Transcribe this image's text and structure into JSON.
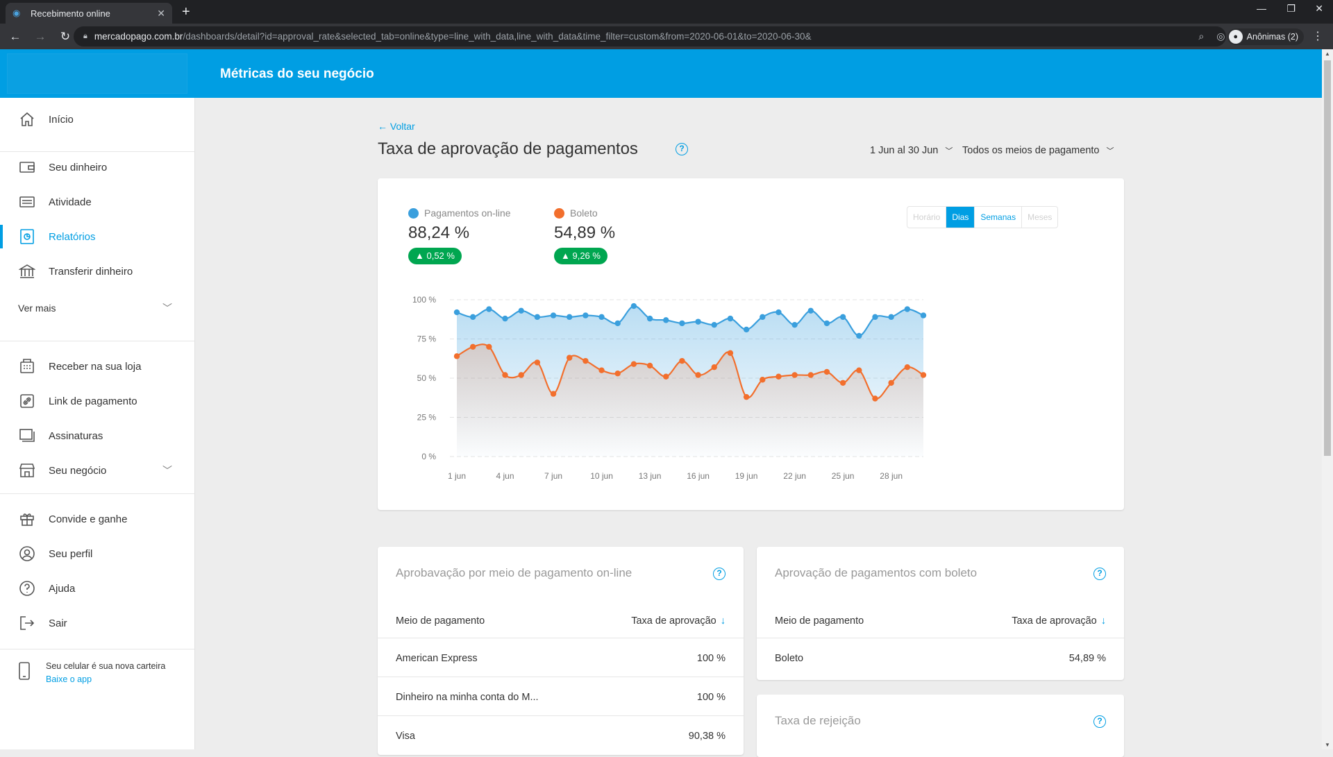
{
  "browser": {
    "tab_title": "Recebimento online",
    "new_tab": "+",
    "url_host": "mercadopago.com.br",
    "url_path": "/dashboards/detail?id=approval_rate&selected_tab=online&type=line_with_data,line_with_data&time_filter=custom&from=2020-06-01&to=2020-06-30&",
    "profile_label": "Anônimas (2)"
  },
  "header": {
    "title": "Métricas do seu negócio"
  },
  "sidebar": {
    "items": [
      {
        "label": "Início"
      },
      {
        "label": "Seu dinheiro"
      },
      {
        "label": "Atividade"
      },
      {
        "label": "Relatórios"
      },
      {
        "label": "Transferir dinheiro"
      },
      {
        "label": "Ver mais"
      },
      {
        "label": "Receber na sua loja"
      },
      {
        "label": "Link de pagamento"
      },
      {
        "label": "Assinaturas"
      },
      {
        "label": "Seu negócio"
      },
      {
        "label": "Convide e ganhe"
      },
      {
        "label": "Seu perfil"
      },
      {
        "label": "Ajuda"
      },
      {
        "label": "Sair"
      }
    ],
    "promo_text": "Seu celular é sua nova carteira",
    "promo_link": "Baixe o app"
  },
  "main": {
    "back": "← Voltar",
    "title": "Taxa de aprovação de pagamentos",
    "date_filter": "1 Jun al 30 Jun",
    "method_filter": "Todos os meios de pagamento"
  },
  "summary": {
    "online": {
      "label": "Pagamentos on-line",
      "value": "88,24 %",
      "delta": "▲ 0,52 %",
      "color": "#3a9fdd"
    },
    "boleto": {
      "label": "Boleto",
      "value": "54,89 %",
      "delta": "▲ 9,26 %",
      "color": "#f26f2d"
    }
  },
  "granularity": {
    "options": [
      "Horário",
      "Dias",
      "Semanas",
      "Meses"
    ],
    "selected": "Dias"
  },
  "chart_data": {
    "type": "area",
    "x": [
      "1 jun",
      "2 jun",
      "3 jun",
      "4 jun",
      "5 jun",
      "6 jun",
      "7 jun",
      "8 jun",
      "9 jun",
      "10 jun",
      "11 jun",
      "12 jun",
      "13 jun",
      "14 jun",
      "15 jun",
      "16 jun",
      "17 jun",
      "18 jun",
      "19 jun",
      "20 jun",
      "21 jun",
      "22 jun",
      "23 jun",
      "24 jun",
      "25 jun",
      "26 jun",
      "27 jun",
      "28 jun",
      "29 jun",
      "30 jun"
    ],
    "x_tick_labels": [
      "1 jun",
      "4 jun",
      "7 jun",
      "10 jun",
      "13 jun",
      "16 jun",
      "19 jun",
      "22 jun",
      "25 jun",
      "28 jun"
    ],
    "y_tick_labels": [
      "100 %",
      "75 %",
      "50 %",
      "25 %",
      "0 %"
    ],
    "ylim": [
      0,
      100
    ],
    "series": [
      {
        "name": "Pagamentos on-line",
        "color": "#3a9fdd",
        "values": [
          92,
          89,
          94,
          88,
          93,
          89,
          90,
          89,
          90,
          89,
          85,
          96,
          88,
          87,
          85,
          86,
          84,
          88,
          81,
          89,
          92,
          84,
          93,
          85,
          89,
          77,
          89,
          89,
          94,
          90
        ]
      },
      {
        "name": "Boleto",
        "color": "#f26f2d",
        "values": [
          64,
          70,
          70,
          52,
          52,
          60,
          40,
          63,
          61,
          55,
          53,
          59,
          58,
          51,
          61,
          52,
          57,
          66,
          38,
          49,
          51,
          52,
          52,
          54,
          47,
          55,
          37,
          47,
          57,
          52
        ]
      }
    ]
  },
  "table_online": {
    "title": "Aprobavação por meio de pagamento on-line",
    "col1": "Meio de pagamento",
    "col2": "Taxa de aprovação",
    "arrow": "↓",
    "rows": [
      {
        "name": "American Express",
        "value": "100 %"
      },
      {
        "name": "Dinheiro na minha conta do M...",
        "value": "100 %"
      },
      {
        "name": "Visa",
        "value": "90,38 %"
      }
    ]
  },
  "table_boleto": {
    "title": "Aprovação de pagamentos com boleto",
    "col1": "Meio de pagamento",
    "col2": "Taxa de aprovação",
    "arrow": "↓",
    "rows": [
      {
        "name": "Boleto",
        "value": "54,89 %"
      }
    ]
  },
  "rejection": {
    "title": "Taxa de rejeição"
  }
}
